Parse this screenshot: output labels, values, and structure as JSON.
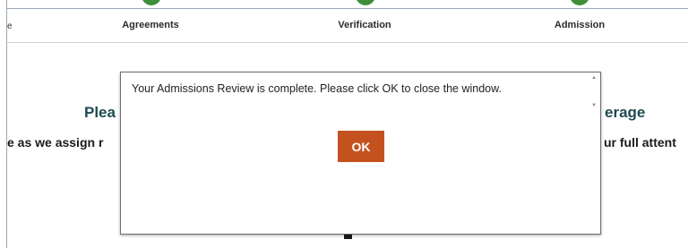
{
  "steps": [
    {
      "label": "Agreements"
    },
    {
      "label": "Verification"
    },
    {
      "label": "Admission"
    }
  ],
  "step_color": "#3e8e3a",
  "left_tick": "e",
  "background": {
    "heading_left": "Plea",
    "heading_right": "erage",
    "sub_left": "e as we assign r",
    "sub_right": "ur full attent"
  },
  "dialog": {
    "message": "Your Admissions Review is complete. Please click OK to close the window.",
    "ok_label": "OK",
    "ok_color": "#c4521f",
    "scroll_up_icon": "triangle-up-icon",
    "scroll_down_icon": "triangle-down-icon"
  }
}
